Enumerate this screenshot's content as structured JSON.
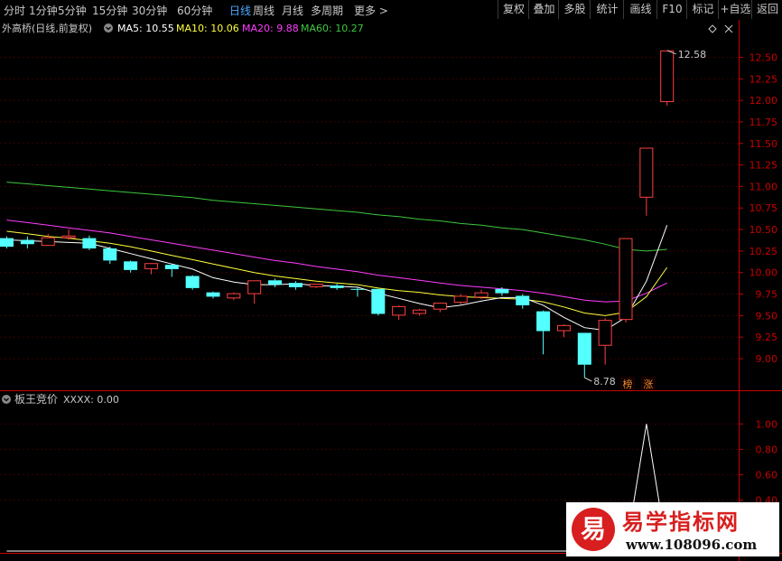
{
  "toolbar": {
    "periods": [
      "分时",
      "1分钟",
      "5分钟",
      "15分钟",
      "30分钟",
      "60分钟",
      "日线",
      "周线",
      "月线",
      "多周期",
      "更多 >"
    ],
    "active_period": "日线",
    "buttons": [
      "复权",
      "叠加",
      "多股",
      "统计",
      "画线",
      "F10",
      "标记",
      "+自选",
      "返回"
    ]
  },
  "colors": {
    "up": "#ff4040",
    "down": "#54ffff",
    "ma5": "#ffffff",
    "ma10": "#ffff3c",
    "ma20": "#ff3cff",
    "ma60": "#3cc83c",
    "axis": "#c80000"
  },
  "main_panel": {
    "stock_name": "外高桥(日线,前复权)",
    "ma_labels": [
      {
        "text": "MA5: 10.55",
        "color": "#ffffff"
      },
      {
        "text": "MA10: 10.06",
        "color": "#ffff3c"
      },
      {
        "text": "MA20: 9.88",
        "color": "#ff3cff"
      },
      {
        "text": "MA60: 10.27",
        "color": "#3cc83c"
      }
    ]
  },
  "sub_panel": {
    "title": "板王竞价",
    "value_label": "XXXX: 0.00"
  },
  "watermark": {
    "mark": "易",
    "title": "易学指标网",
    "url": "www.108096.com"
  },
  "chart_data": {
    "type": "candlestick",
    "y_ticks": [
      "12.50",
      "12.25",
      "12.00",
      "11.75",
      "11.50",
      "11.25",
      "11.00",
      "10.75",
      "10.50",
      "10.25",
      "10.00",
      "9.75",
      "9.50",
      "9.25",
      "9.00"
    ],
    "ylim": [
      8.78,
      12.62
    ],
    "high_label": "12.58",
    "low_label": "8.78",
    "candles": [
      {
        "o": 10.4,
        "c": 10.3,
        "h": 10.42,
        "l": 10.28
      },
      {
        "o": 10.38,
        "c": 10.33,
        "h": 10.42,
        "l": 10.28
      },
      {
        "o": 10.31,
        "c": 10.41,
        "h": 10.45,
        "l": 10.31
      },
      {
        "o": 10.4,
        "c": 10.43,
        "h": 10.5,
        "l": 10.38
      },
      {
        "o": 10.4,
        "c": 10.28,
        "h": 10.43,
        "l": 10.26
      },
      {
        "o": 10.28,
        "c": 10.14,
        "h": 10.3,
        "l": 10.1
      },
      {
        "o": 10.13,
        "c": 10.03,
        "h": 10.14,
        "l": 10.0
      },
      {
        "o": 10.04,
        "c": 10.11,
        "h": 10.11,
        "l": 9.98
      },
      {
        "o": 10.09,
        "c": 10.04,
        "h": 10.1,
        "l": 9.95
      },
      {
        "o": 9.96,
        "c": 9.82,
        "h": 9.97,
        "l": 9.8
      },
      {
        "o": 9.77,
        "c": 9.72,
        "h": 9.78,
        "l": 9.7
      },
      {
        "o": 9.7,
        "c": 9.76,
        "h": 9.77,
        "l": 9.68
      },
      {
        "o": 9.75,
        "c": 9.91,
        "h": 9.91,
        "l": 9.64
      },
      {
        "o": 9.91,
        "c": 9.86,
        "h": 9.93,
        "l": 9.83
      },
      {
        "o": 9.88,
        "c": 9.83,
        "h": 9.9,
        "l": 9.8
      },
      {
        "o": 9.83,
        "c": 9.87,
        "h": 9.87,
        "l": 9.82
      },
      {
        "o": 9.85,
        "c": 9.82,
        "h": 9.87,
        "l": 9.8
      },
      {
        "o": 9.81,
        "c": 9.8,
        "h": 9.83,
        "l": 9.72
      },
      {
        "o": 9.81,
        "c": 9.52,
        "h": 9.81,
        "l": 9.5
      },
      {
        "o": 9.5,
        "c": 9.61,
        "h": 9.62,
        "l": 9.45
      },
      {
        "o": 9.52,
        "c": 9.57,
        "h": 9.58,
        "l": 9.5
      },
      {
        "o": 9.57,
        "c": 9.65,
        "h": 9.65,
        "l": 9.54
      },
      {
        "o": 9.65,
        "c": 9.73,
        "h": 9.75,
        "l": 9.63
      },
      {
        "o": 9.71,
        "c": 9.77,
        "h": 9.8,
        "l": 9.69
      },
      {
        "o": 9.81,
        "c": 9.76,
        "h": 9.83,
        "l": 9.73
      },
      {
        "o": 9.73,
        "c": 9.62,
        "h": 9.75,
        "l": 9.58
      },
      {
        "o": 9.55,
        "c": 9.32,
        "h": 9.56,
        "l": 9.05
      },
      {
        "o": 9.32,
        "c": 9.39,
        "h": 9.4,
        "l": 9.25
      },
      {
        "o": 9.3,
        "c": 8.93,
        "h": 9.3,
        "l": 8.78
      },
      {
        "o": 9.15,
        "c": 9.45,
        "h": 9.47,
        "l": 8.93
      },
      {
        "o": 9.45,
        "c": 10.4,
        "h": 10.4,
        "l": 9.42
      },
      {
        "o": 10.87,
        "c": 11.45,
        "h": 11.45,
        "l": 10.66
      },
      {
        "o": 11.98,
        "c": 12.58,
        "h": 12.58,
        "l": 11.94
      }
    ],
    "ma": {
      "ma5": [
        10.38,
        10.37,
        10.36,
        10.35,
        10.34,
        10.28,
        10.22,
        10.16,
        10.1,
        10.04,
        9.94,
        9.89,
        9.86,
        9.86,
        9.87,
        9.85,
        9.84,
        9.83,
        9.76,
        9.7,
        9.64,
        9.59,
        9.62,
        9.67,
        9.71,
        9.71,
        9.62,
        9.48,
        9.36,
        9.33,
        9.48,
        9.9,
        10.55
      ],
      "ma10": [
        10.48,
        10.45,
        10.42,
        10.4,
        10.37,
        10.34,
        10.3,
        10.25,
        10.2,
        10.15,
        10.1,
        10.05,
        10.0,
        9.96,
        9.93,
        9.9,
        9.88,
        9.86,
        9.82,
        9.79,
        9.77,
        9.74,
        9.72,
        9.71,
        9.7,
        9.69,
        9.66,
        9.6,
        9.53,
        9.5,
        9.54,
        9.72,
        10.06
      ],
      "ma20": [
        10.61,
        10.58,
        10.55,
        10.52,
        10.49,
        10.46,
        10.42,
        10.38,
        10.34,
        10.3,
        10.26,
        10.22,
        10.18,
        10.14,
        10.11,
        10.07,
        10.04,
        10.01,
        9.97,
        9.94,
        9.91,
        9.88,
        9.85,
        9.83,
        9.81,
        9.79,
        9.76,
        9.72,
        9.68,
        9.66,
        9.67,
        9.76,
        9.88
      ],
      "ma60": [
        11.05,
        11.03,
        11.01,
        10.99,
        10.97,
        10.95,
        10.93,
        10.91,
        10.89,
        10.87,
        10.84,
        10.82,
        10.8,
        10.78,
        10.76,
        10.74,
        10.72,
        10.7,
        10.67,
        10.65,
        10.62,
        10.6,
        10.57,
        10.55,
        10.52,
        10.5,
        10.46,
        10.42,
        10.38,
        10.33,
        10.27,
        10.25,
        10.27
      ]
    },
    "markers": [
      {
        "candle": 30,
        "text": "榜"
      },
      {
        "candle": 31,
        "text": "涨"
      }
    ],
    "sub": {
      "y_ticks": [
        "1.00",
        "0.80",
        "0.60",
        "0.40"
      ],
      "ylim": [
        0,
        1.08
      ],
      "values": [
        0,
        0,
        0,
        0,
        0,
        0,
        0,
        0,
        0,
        0,
        0,
        0,
        0,
        0,
        0,
        0,
        0,
        0,
        0,
        0,
        0,
        0,
        0,
        0,
        0,
        0,
        0,
        0,
        0,
        0,
        0,
        1.0,
        0
      ]
    }
  }
}
